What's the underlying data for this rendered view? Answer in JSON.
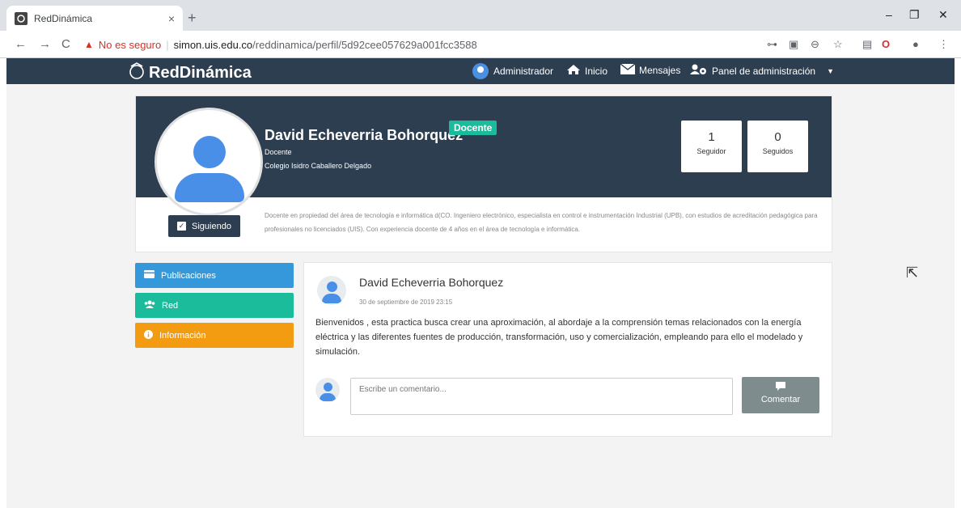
{
  "browser": {
    "tab_title": "RedDinámica",
    "tab_close": "×",
    "new_tab": "+",
    "win_minimize": "–",
    "win_restore": "❐",
    "win_close": "✕",
    "insecure_label": "No es seguro",
    "url_host": "simon.uis.edu.co",
    "url_path": "/reddinamica/perfil/5d92cee057629a001fcc3588"
  },
  "navbar": {
    "brand": "RedDinámica",
    "user": "Administrador",
    "home": "Inicio",
    "messages": "Mensajes",
    "admin_panel": "Panel de administración"
  },
  "profile": {
    "name": "David Echeverria Bohorquez",
    "badge": "Docente",
    "role": "Docente",
    "school": "Colegio Isidro Caballero Delgado",
    "followers_count": "1",
    "followers_label": "Seguidor",
    "following_count": "0",
    "following_label": "Seguidos",
    "follow_button": "Siguiendo",
    "bio": "Docente en propiedad del área de tecnología e informática d(CO. Ingeniero electrónico, especialista en control e instrumentación Industrial (UPB), con estudios de acreditación pedagógica para profesionales no licenciados (UIS). Con experiencia docente de 4 años en el área de tecnología e informática."
  },
  "menu": {
    "items": [
      {
        "label": "Publicaciones",
        "color": "#3498db"
      },
      {
        "label": "Red",
        "color": "#1abc9c"
      },
      {
        "label": "Información",
        "color": "#f39c12"
      }
    ]
  },
  "post": {
    "author": "David Echeverria Bohorquez",
    "date": "30 de septiembre de 2019 23:15",
    "body": "Bienvenidos , esta practica busca crear una aproximación, al abordaje a la comprensión temas relacionados con la energía eléctrica y las diferentes fuentes de producción, transformación, uso y comercialización, empleando para ello el modelado y simulación.",
    "comment_placeholder": "Escribe un comentario...",
    "comment_button": "Comentar"
  }
}
